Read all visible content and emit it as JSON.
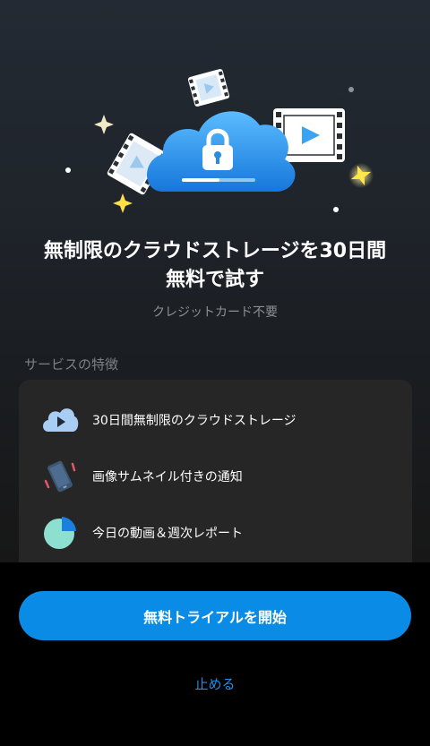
{
  "hero": {
    "headline_line1": "無制限のクラウドストレージを30日間",
    "headline_line2": "無料で試す",
    "subhead": "クレジットカード不要",
    "illustration_icons": [
      "cloud-lock-icon",
      "film-strip-icon",
      "sparkle-icon",
      "upload-progress-icon"
    ]
  },
  "features": {
    "title": "サービスの特徴",
    "items": [
      {
        "icon": "cloud-play-icon",
        "label": "30日間無制限のクラウドストレージ"
      },
      {
        "icon": "phone-vibrate-icon",
        "label": "画像サムネイル付きの通知"
      },
      {
        "icon": "pie-chart-icon",
        "label": "今日の動画＆週次レポート"
      }
    ]
  },
  "actions": {
    "start_trial_label": "無料トライアルを開始",
    "stop_label": "止める"
  },
  "colors": {
    "accent": "#0a8be6",
    "link": "#1a90e8",
    "cloud_gradient_top": "#4fb6ff",
    "cloud_gradient_bottom": "#1a7fe0"
  }
}
